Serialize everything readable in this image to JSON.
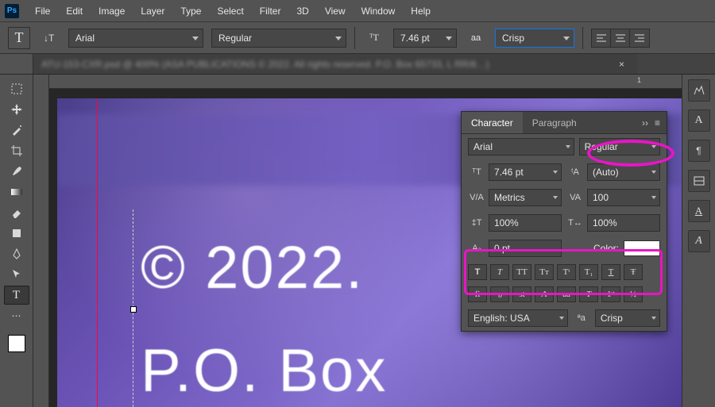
{
  "app": {
    "logo": "Ps"
  },
  "menu": [
    "File",
    "Edit",
    "Image",
    "Layer",
    "Type",
    "Select",
    "Filter",
    "3D",
    "View",
    "Window",
    "Help"
  ],
  "options": {
    "font_family": "Arial",
    "font_style": "Regular",
    "font_size": "7.46 pt",
    "aa_label": "aa",
    "antialias": "Crisp"
  },
  "document": {
    "tab_title": "ATU-153-CXR.psd @ 400% (ASA PUBLICATIONS © 2022. All rights reserved. P.O. Box 65733, L RR/8…)"
  },
  "ruler": {
    "mark": "1"
  },
  "canvas": {
    "line1": "© 2022.",
    "line2": "P.O. Box"
  },
  "char_panel": {
    "tabs": {
      "character": "Character",
      "paragraph": "Paragraph"
    },
    "font_family": "Arial",
    "font_style": "Regular",
    "size": "7.46 pt",
    "leading": "(Auto)",
    "kerning": "Metrics",
    "tracking": "100",
    "vscale": "100%",
    "hscale": "100%",
    "baseline": "0 pt",
    "color_label": "Color:",
    "style_buttons_row1": [
      "T",
      "T",
      "TT",
      "Tᴛ",
      "Tᵗ",
      "T₁",
      "T",
      "Ŧ"
    ],
    "style_buttons_row2": [
      "fi",
      "ℴ",
      "st",
      "A",
      "aa",
      "T",
      "1ˢᵗ",
      "½"
    ],
    "language": "English: USA",
    "aa": "Crisp"
  }
}
